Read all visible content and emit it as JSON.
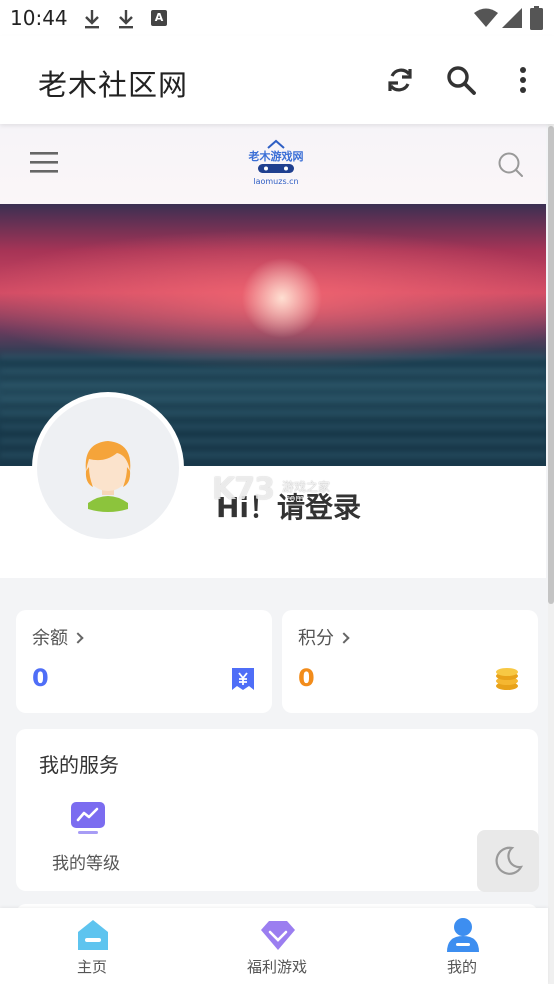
{
  "status_bar": {
    "time": "10:44",
    "app_badge": "A"
  },
  "app_bar": {
    "title": "老木社区网",
    "actions": [
      "refresh-icon",
      "search-icon",
      "more-vert-icon"
    ]
  },
  "site_header": {
    "logo_text": "老木游戏网",
    "logo_sub": "laomuzs.cn"
  },
  "profile": {
    "greeting": "Hi！请登录"
  },
  "watermark": {
    "main": "K73",
    "sub": "游戏之家",
    "url": ".com"
  },
  "balance_card": {
    "label": "余额",
    "value": "0",
    "value_color": "#4f6ef7",
    "icon": "yen-ticket-icon"
  },
  "points_card": {
    "label": "积分",
    "value": "0",
    "value_color": "#f28c1b",
    "icon": "coins-icon"
  },
  "services": {
    "title": "我的服务",
    "items": [
      {
        "label": "我的等级",
        "icon": "chart-monitor-icon"
      }
    ]
  },
  "bottom_nav": {
    "items": [
      {
        "label": "主页",
        "icon": "home-icon"
      },
      {
        "label": "福利游戏",
        "icon": "diamond-icon"
      },
      {
        "label": "我的",
        "icon": "user-icon"
      }
    ]
  },
  "colors": {
    "accent_blue": "#4f6ef7",
    "accent_orange": "#f28c1b",
    "purple": "#7b6cf0"
  }
}
